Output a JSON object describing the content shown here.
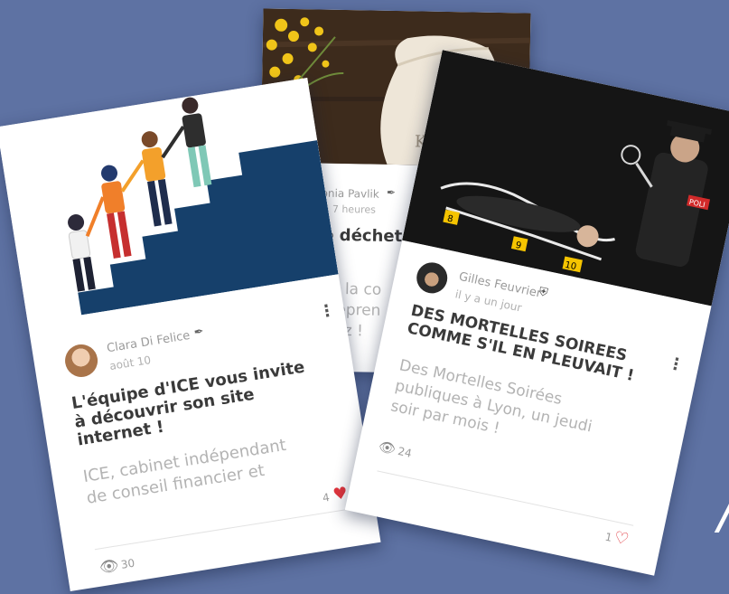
{
  "cards": [
    {
      "author": "Sonia Pavlik",
      "date": "y a 7 heures",
      "title": "o déchet,",
      "excerpt_lines": [
        "à la co",
        "repren",
        "biz !"
      ],
      "bag_text": "Kims"
    },
    {
      "author": "Clara Di Felice",
      "date": "août 10",
      "title_lines": [
        "L'équipe d'ICE vous invite",
        "à découvrir son site",
        "internet !"
      ],
      "excerpt_lines": [
        "ICE, cabinet indépendant",
        "de conseil financier et"
      ],
      "likes": "4",
      "views": "30"
    },
    {
      "author": "Gilles Feuvrier",
      "date": "il y a un jour",
      "title_lines": [
        "DES MORTELLES SOIREES",
        "COMME S'IL EN PLEUVAIT !"
      ],
      "excerpt_lines": [
        "Des Mortelles Soirées",
        "publiques à Lyon, un jeudi",
        "soir par mois !"
      ],
      "likes": "1",
      "views": "24",
      "markers": [
        "8",
        "9",
        "10"
      ],
      "police_badge": "POLI"
    }
  ],
  "colors": {
    "background": "#5e72a3",
    "heart_red": "#e0343c",
    "stairs_navy": "#16406b"
  },
  "icons": [
    "feather-icon",
    "eye-icon",
    "heart-icon",
    "kebab-icon",
    "verified-shield-icon"
  ]
}
